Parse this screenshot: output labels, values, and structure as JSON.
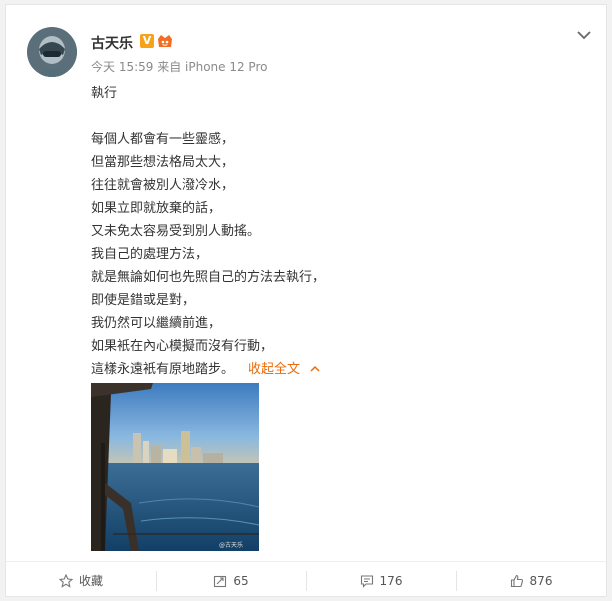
{
  "post": {
    "username": "古天乐",
    "verified_badge": "V",
    "meta": "今天 15:59 来自 iPhone 12 Pro",
    "body_lines": [
      "執行",
      "",
      "每個人都會有一些靈感，",
      "但當那些想法格局太大，",
      "往往就會被別人潑冷水，",
      "如果立即就放棄的話，",
      "又未免太容易受到別人動搖。",
      "我自己的處理方法，",
      "就是無論如何也先照自己的方法去執行，",
      "即使是錯或是對，",
      "我仍然可以繼續前進，",
      "如果衹在內心模擬而沒有行動，",
      "這樣永遠衹有原地踏步。"
    ],
    "collapse_label": "收起全文",
    "collapse_caret": "^",
    "photo_watermark": "@古天乐"
  },
  "actions": {
    "favorite_label": "收藏",
    "repost_count": "65",
    "comment_count": "176",
    "like_count": "876"
  },
  "icons": {
    "more": "chevron-down-icon",
    "favorite": "star-icon",
    "repost": "repost-icon",
    "comment": "comment-icon",
    "like": "thumbs-up-icon"
  },
  "colors": {
    "accent": "#e86b0c",
    "verified": "#f7a21b",
    "text": "#333333",
    "meta": "#8a8a8a"
  }
}
